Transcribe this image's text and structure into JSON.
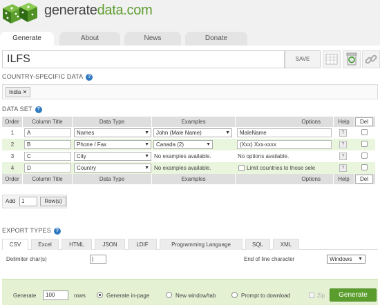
{
  "app": {
    "logo_prefix": "generate",
    "logo_suffix": "data.com"
  },
  "main_tabs": [
    "Generate",
    "About",
    "News",
    "Donate"
  ],
  "config": {
    "title_value": "ILFS",
    "save_label": "SAVE"
  },
  "country_section": {
    "label": "COUNTRY-SPECIFIC DATA",
    "selected": "India",
    "remove": "✕"
  },
  "dataset": {
    "label": "DATA SET",
    "columns": [
      "Order",
      "Column Title",
      "Data Type",
      "Examples",
      "Options",
      "Help",
      "Del"
    ],
    "rows": [
      {
        "order": "1",
        "title": "A",
        "type": "Names",
        "example": "John (Male Name)",
        "example_is_select": true,
        "options": "MaleName",
        "options_kind": "input"
      },
      {
        "order": "2",
        "title": "B",
        "type": "Phone / Fax",
        "example": "Canada (2)",
        "example_is_select": true,
        "options": "(Xxx) Xxx-xxxx",
        "options_kind": "input"
      },
      {
        "order": "3",
        "title": "C",
        "type": "City",
        "example": "No examples available.",
        "example_is_select": false,
        "options": "No options available.",
        "options_kind": "text"
      },
      {
        "order": "4",
        "title": "D",
        "type": "Country",
        "example": "No examples available.",
        "example_is_select": false,
        "options": "Limit countries to those sele",
        "options_kind": "checkbox"
      }
    ],
    "help_mark": "?",
    "del_label": "Del"
  },
  "add_rows": {
    "label": "Add",
    "count": "1",
    "button": "Row(s)"
  },
  "export": {
    "label": "EXPORT TYPES",
    "tabs": [
      "CSV",
      "Excel",
      "HTML",
      "JSON",
      "LDIF",
      "Programming Language",
      "SQL",
      "XML"
    ],
    "delimiter_label": "Delimiter char(s)",
    "delimiter_value": "|",
    "eol_label": "End of line character",
    "eol_value": "Windows"
  },
  "generate": {
    "label": "Generate",
    "rows": "100",
    "rows_suffix": "rows",
    "options": [
      "Generate in-page",
      "New window/tab",
      "Prompt to download"
    ],
    "zip_label": "Zip",
    "button": "Generate"
  },
  "colors": {
    "accent_green": "#5a9d2c",
    "row_alt": "#eaf5dd",
    "help_blue": "#2f79c0"
  }
}
